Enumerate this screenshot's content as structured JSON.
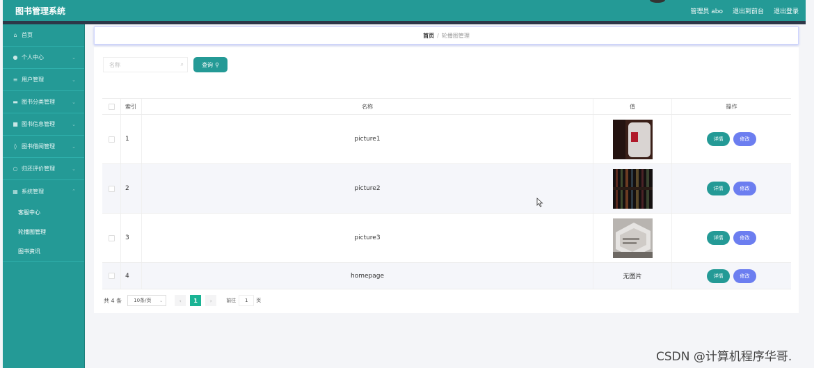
{
  "header": {
    "title": "图书管理系统",
    "user_label": "管理员 abo",
    "to_front": "退出到前台",
    "logout": "退出登录"
  },
  "sidebar": {
    "items": [
      {
        "label": "首页",
        "icon": "home-icon",
        "glyph": "⌂",
        "has_chevron": false
      },
      {
        "label": "个人中心",
        "icon": "user-icon",
        "glyph": "●",
        "has_chevron": true
      },
      {
        "label": "用户管理",
        "icon": "list-icon",
        "glyph": "≡",
        "has_chevron": true
      },
      {
        "label": "图书分类管理",
        "icon": "category-icon",
        "glyph": "▬",
        "has_chevron": true
      },
      {
        "label": "图书信息管理",
        "icon": "book-icon",
        "glyph": "■",
        "has_chevron": true
      },
      {
        "label": "图书借阅管理",
        "icon": "location-icon",
        "glyph": "◊",
        "has_chevron": true
      },
      {
        "label": "归还评价管理",
        "icon": "circle-icon",
        "glyph": "○",
        "has_chevron": true
      },
      {
        "label": "系统管理",
        "icon": "system-icon",
        "glyph": "▦",
        "has_chevron": true
      }
    ],
    "sub_items": [
      "客服中心",
      "轮播图管理",
      "图书资讯"
    ]
  },
  "breadcrumb": {
    "home": "首页",
    "separator": "/",
    "current": "轮播图管理"
  },
  "search": {
    "placeholder": "名称",
    "button": "查询"
  },
  "table": {
    "columns": [
      "索引",
      "名称",
      "值",
      "操作"
    ],
    "rows": [
      {
        "index": "1",
        "name": "picture1",
        "value": "",
        "thumb": "dark-red"
      },
      {
        "index": "2",
        "name": "picture2",
        "value": "",
        "thumb": "dark-stripes"
      },
      {
        "index": "3",
        "name": "picture3",
        "value": "",
        "thumb": "light-gray"
      },
      {
        "index": "4",
        "name": "homepage",
        "value": "无图片",
        "thumb": ""
      }
    ],
    "detail_label": "详情",
    "edit_label": "修改"
  },
  "pagination": {
    "total": "共 4 条",
    "page_size": "10条/页",
    "current_page": "1",
    "goto_label": "前往",
    "goto_value": "1",
    "page_word": "页"
  },
  "watermark": "CSDN @计算机程序华哥.",
  "colors": {
    "primary": "#249a96",
    "edit": "#6c7ef0",
    "pager_active": "#1ab394"
  }
}
